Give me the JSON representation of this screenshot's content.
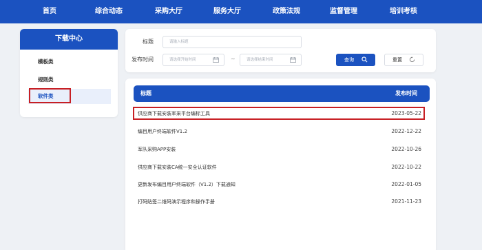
{
  "nav": {
    "items": [
      "首页",
      "综合动态",
      "采购大厅",
      "服务大厅",
      "政策法规",
      "监督管理",
      "培训考核"
    ]
  },
  "sidebar": {
    "title": "下载中心",
    "items": [
      {
        "label": "模板类"
      },
      {
        "label": "规则类"
      },
      {
        "label": "软件类"
      }
    ]
  },
  "search": {
    "title_label": "标题",
    "title_placeholder": "请输入标题",
    "date_label": "发布时间",
    "start_placeholder": "请选择开始时间",
    "date_separator": "~",
    "end_placeholder": "请选择结束时间",
    "query_label": "查询",
    "reset_label": "重置"
  },
  "table": {
    "col_title": "标题",
    "col_date": "发布时间",
    "rows": [
      {
        "title": "供应商下载安装军采平台编标工具",
        "date": "2023-05-22"
      },
      {
        "title": "编目用户终端软件V1.2",
        "date": "2022-12-22"
      },
      {
        "title": "军队采购APP安装",
        "date": "2022-10-26"
      },
      {
        "title": "供应商下载安装CA统一安全认证软件",
        "date": "2022-10-22"
      },
      {
        "title": "更新发布编目用户终端软件（V1.2）下载通知",
        "date": "2022-01-05"
      },
      {
        "title": "打码贴签二维码演示程序和操作手册",
        "date": "2021-11-23"
      }
    ]
  },
  "colors": {
    "primary": "#1b52c0",
    "highlight": "#c71f24",
    "background": "#eef1f5"
  }
}
